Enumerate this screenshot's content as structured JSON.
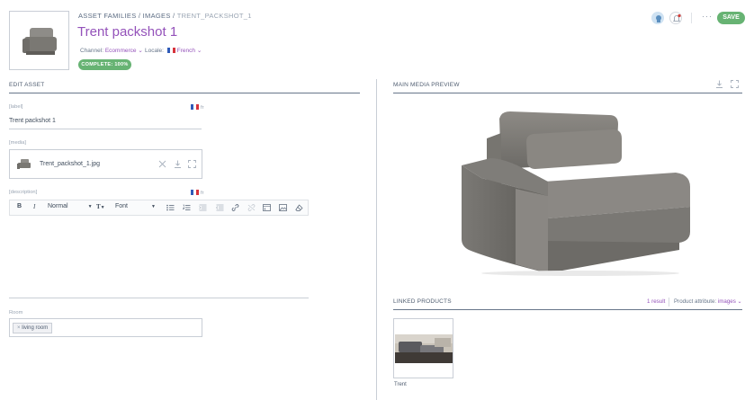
{
  "breadcrumb": {
    "part1": "ASSET FAMILIES",
    "sep1": " / ",
    "part2": "IMAGES",
    "sep2": " / ",
    "current": "TRENT_PACKSHOT_1"
  },
  "title": "Trent packshot 1",
  "channel": {
    "label": "Channel:",
    "value": "Ecommerce"
  },
  "locale": {
    "label": "Locale:",
    "value": "French"
  },
  "completeness": "COMPLETE: 100%",
  "actions": {
    "more": "···",
    "save": "SAVE"
  },
  "edit_asset": {
    "heading": "EDIT ASSET",
    "label_field": {
      "label": "[label]",
      "locale": "fr",
      "value": "Trent packshot 1"
    },
    "media_field": {
      "label": "[media]",
      "filename": "Trent_packshot_1.jpg"
    },
    "description_field": {
      "label": "[description]",
      "locale": "fr",
      "toolbar": {
        "bold": "B",
        "italic": "I",
        "heading": "Normal",
        "size": "T",
        "font": "Font"
      }
    },
    "room_field": {
      "label": "Room",
      "tag": "living room"
    }
  },
  "preview": {
    "heading": "MAIN MEDIA PREVIEW"
  },
  "linked": {
    "heading": "LINKED PRODUCTS",
    "count": "1 result",
    "attr_label": "Product attribute:",
    "attr_value": "images",
    "products": [
      {
        "name": "Trent"
      }
    ]
  },
  "colors": {
    "accent": "#9452ba",
    "success": "#67b373",
    "text": "#67768a"
  }
}
